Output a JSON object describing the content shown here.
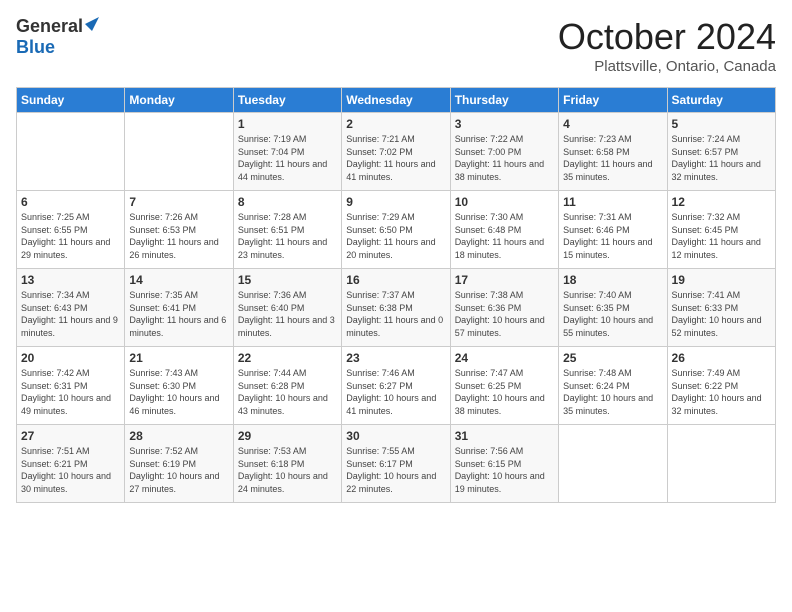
{
  "header": {
    "logo_general": "General",
    "logo_blue": "Blue",
    "month": "October 2024",
    "location": "Plattsville, Ontario, Canada"
  },
  "weekdays": [
    "Sunday",
    "Monday",
    "Tuesday",
    "Wednesday",
    "Thursday",
    "Friday",
    "Saturday"
  ],
  "weeks": [
    [
      {
        "day": "",
        "sunrise": "",
        "sunset": "",
        "daylight": ""
      },
      {
        "day": "",
        "sunrise": "",
        "sunset": "",
        "daylight": ""
      },
      {
        "day": "1",
        "sunrise": "Sunrise: 7:19 AM",
        "sunset": "Sunset: 7:04 PM",
        "daylight": "Daylight: 11 hours and 44 minutes."
      },
      {
        "day": "2",
        "sunrise": "Sunrise: 7:21 AM",
        "sunset": "Sunset: 7:02 PM",
        "daylight": "Daylight: 11 hours and 41 minutes."
      },
      {
        "day": "3",
        "sunrise": "Sunrise: 7:22 AM",
        "sunset": "Sunset: 7:00 PM",
        "daylight": "Daylight: 11 hours and 38 minutes."
      },
      {
        "day": "4",
        "sunrise": "Sunrise: 7:23 AM",
        "sunset": "Sunset: 6:58 PM",
        "daylight": "Daylight: 11 hours and 35 minutes."
      },
      {
        "day": "5",
        "sunrise": "Sunrise: 7:24 AM",
        "sunset": "Sunset: 6:57 PM",
        "daylight": "Daylight: 11 hours and 32 minutes."
      }
    ],
    [
      {
        "day": "6",
        "sunrise": "Sunrise: 7:25 AM",
        "sunset": "Sunset: 6:55 PM",
        "daylight": "Daylight: 11 hours and 29 minutes."
      },
      {
        "day": "7",
        "sunrise": "Sunrise: 7:26 AM",
        "sunset": "Sunset: 6:53 PM",
        "daylight": "Daylight: 11 hours and 26 minutes."
      },
      {
        "day": "8",
        "sunrise": "Sunrise: 7:28 AM",
        "sunset": "Sunset: 6:51 PM",
        "daylight": "Daylight: 11 hours and 23 minutes."
      },
      {
        "day": "9",
        "sunrise": "Sunrise: 7:29 AM",
        "sunset": "Sunset: 6:50 PM",
        "daylight": "Daylight: 11 hours and 20 minutes."
      },
      {
        "day": "10",
        "sunrise": "Sunrise: 7:30 AM",
        "sunset": "Sunset: 6:48 PM",
        "daylight": "Daylight: 11 hours and 18 minutes."
      },
      {
        "day": "11",
        "sunrise": "Sunrise: 7:31 AM",
        "sunset": "Sunset: 6:46 PM",
        "daylight": "Daylight: 11 hours and 15 minutes."
      },
      {
        "day": "12",
        "sunrise": "Sunrise: 7:32 AM",
        "sunset": "Sunset: 6:45 PM",
        "daylight": "Daylight: 11 hours and 12 minutes."
      }
    ],
    [
      {
        "day": "13",
        "sunrise": "Sunrise: 7:34 AM",
        "sunset": "Sunset: 6:43 PM",
        "daylight": "Daylight: 11 hours and 9 minutes."
      },
      {
        "day": "14",
        "sunrise": "Sunrise: 7:35 AM",
        "sunset": "Sunset: 6:41 PM",
        "daylight": "Daylight: 11 hours and 6 minutes."
      },
      {
        "day": "15",
        "sunrise": "Sunrise: 7:36 AM",
        "sunset": "Sunset: 6:40 PM",
        "daylight": "Daylight: 11 hours and 3 minutes."
      },
      {
        "day": "16",
        "sunrise": "Sunrise: 7:37 AM",
        "sunset": "Sunset: 6:38 PM",
        "daylight": "Daylight: 11 hours and 0 minutes."
      },
      {
        "day": "17",
        "sunrise": "Sunrise: 7:38 AM",
        "sunset": "Sunset: 6:36 PM",
        "daylight": "Daylight: 10 hours and 57 minutes."
      },
      {
        "day": "18",
        "sunrise": "Sunrise: 7:40 AM",
        "sunset": "Sunset: 6:35 PM",
        "daylight": "Daylight: 10 hours and 55 minutes."
      },
      {
        "day": "19",
        "sunrise": "Sunrise: 7:41 AM",
        "sunset": "Sunset: 6:33 PM",
        "daylight": "Daylight: 10 hours and 52 minutes."
      }
    ],
    [
      {
        "day": "20",
        "sunrise": "Sunrise: 7:42 AM",
        "sunset": "Sunset: 6:31 PM",
        "daylight": "Daylight: 10 hours and 49 minutes."
      },
      {
        "day": "21",
        "sunrise": "Sunrise: 7:43 AM",
        "sunset": "Sunset: 6:30 PM",
        "daylight": "Daylight: 10 hours and 46 minutes."
      },
      {
        "day": "22",
        "sunrise": "Sunrise: 7:44 AM",
        "sunset": "Sunset: 6:28 PM",
        "daylight": "Daylight: 10 hours and 43 minutes."
      },
      {
        "day": "23",
        "sunrise": "Sunrise: 7:46 AM",
        "sunset": "Sunset: 6:27 PM",
        "daylight": "Daylight: 10 hours and 41 minutes."
      },
      {
        "day": "24",
        "sunrise": "Sunrise: 7:47 AM",
        "sunset": "Sunset: 6:25 PM",
        "daylight": "Daylight: 10 hours and 38 minutes."
      },
      {
        "day": "25",
        "sunrise": "Sunrise: 7:48 AM",
        "sunset": "Sunset: 6:24 PM",
        "daylight": "Daylight: 10 hours and 35 minutes."
      },
      {
        "day": "26",
        "sunrise": "Sunrise: 7:49 AM",
        "sunset": "Sunset: 6:22 PM",
        "daylight": "Daylight: 10 hours and 32 minutes."
      }
    ],
    [
      {
        "day": "27",
        "sunrise": "Sunrise: 7:51 AM",
        "sunset": "Sunset: 6:21 PM",
        "daylight": "Daylight: 10 hours and 30 minutes."
      },
      {
        "day": "28",
        "sunrise": "Sunrise: 7:52 AM",
        "sunset": "Sunset: 6:19 PM",
        "daylight": "Daylight: 10 hours and 27 minutes."
      },
      {
        "day": "29",
        "sunrise": "Sunrise: 7:53 AM",
        "sunset": "Sunset: 6:18 PM",
        "daylight": "Daylight: 10 hours and 24 minutes."
      },
      {
        "day": "30",
        "sunrise": "Sunrise: 7:55 AM",
        "sunset": "Sunset: 6:17 PM",
        "daylight": "Daylight: 10 hours and 22 minutes."
      },
      {
        "day": "31",
        "sunrise": "Sunrise: 7:56 AM",
        "sunset": "Sunset: 6:15 PM",
        "daylight": "Daylight: 10 hours and 19 minutes."
      },
      {
        "day": "",
        "sunrise": "",
        "sunset": "",
        "daylight": ""
      },
      {
        "day": "",
        "sunrise": "",
        "sunset": "",
        "daylight": ""
      }
    ]
  ]
}
